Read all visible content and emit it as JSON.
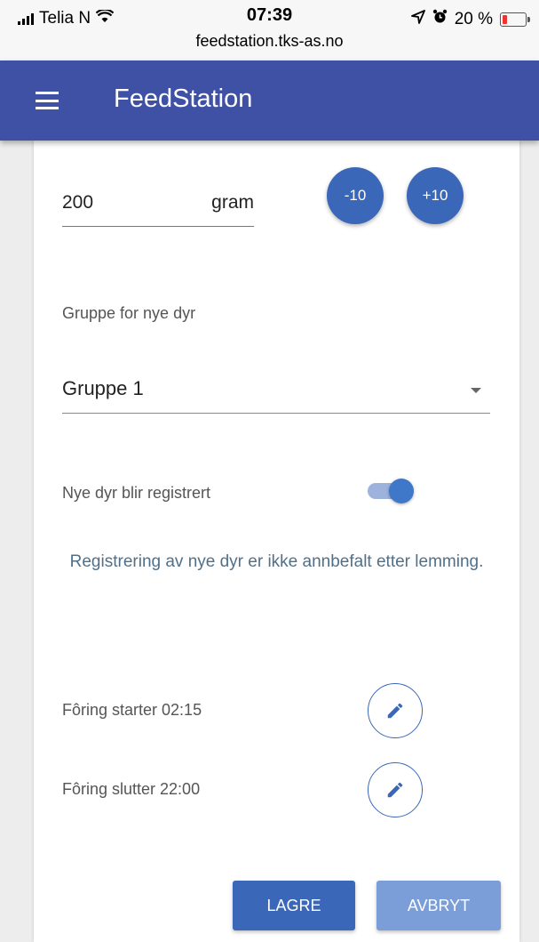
{
  "status_bar": {
    "carrier": "Telia N",
    "time": "07:39",
    "url": "feedstation.tks-as.no",
    "battery_text": "20 %",
    "battery_level": 0.2,
    "icons": [
      "signal-icon",
      "wifi-icon",
      "location-icon",
      "alarm-icon",
      "battery-icon"
    ]
  },
  "app_bar": {
    "title": "FeedStation",
    "menu_icon": "hamburger-menu-icon",
    "color": "#3f51a5"
  },
  "amount": {
    "value": "200",
    "unit": "gram",
    "decrement_label": "-10",
    "increment_label": "+10"
  },
  "group": {
    "label": "Gruppe for nye dyr",
    "selected": "Gruppe 1"
  },
  "registration": {
    "label": "Nye dyr blir registrert",
    "enabled": true,
    "notice": "Registrering av nye dyr er ikke annbefalt etter lemming."
  },
  "feeding": {
    "start_label": "Fôring starter 02:15",
    "end_label": "Fôring slutter 22:00",
    "edit_icon": "pencil-icon"
  },
  "actions": {
    "save_label": "LAGRE",
    "cancel_label": "AVBRYT"
  },
  "colors": {
    "primary": "#3b67b8",
    "primary_light": "#7b9ed9",
    "notice_text": "#50708a"
  }
}
